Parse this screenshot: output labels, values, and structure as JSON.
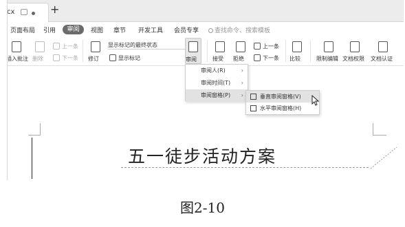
{
  "tab": {
    "title": "cx",
    "new_tab": "+"
  },
  "menubar": {
    "items": [
      "页面布局",
      "引用",
      "审阅",
      "视图",
      "章节",
      "开发工具",
      "会员专享"
    ],
    "active": "审阅",
    "search_placeholder": "查找命令、搜索模板"
  },
  "ribbon": {
    "insert_comment": "插入批注",
    "delete": "删除",
    "prev_comment": "上一条",
    "next_comment": "下一条",
    "revise": "修订",
    "markup_select": "显示标记的最终状态",
    "show_markup": "显示标记",
    "review": "审阅",
    "accept": "接受",
    "reject": "拒绝",
    "prev_change": "上一条",
    "next_change": "下一条",
    "compare": "比较",
    "restrict_edit": "限制编辑",
    "doc_permission": "文档权限",
    "doc_certify": "文档认证"
  },
  "review_menu": {
    "items": [
      {
        "label": "审阅人(R)",
        "arrow": "›"
      },
      {
        "label": "审阅时间(T)",
        "arrow": "›"
      },
      {
        "label": "审阅窗格(P)",
        "arrow": "›"
      }
    ],
    "pane_submenu": [
      "垂直审阅窗格(V)",
      "水平审阅窗格(H)"
    ]
  },
  "document": {
    "title": "五一徒步活动方案"
  },
  "caption": "图2-10"
}
